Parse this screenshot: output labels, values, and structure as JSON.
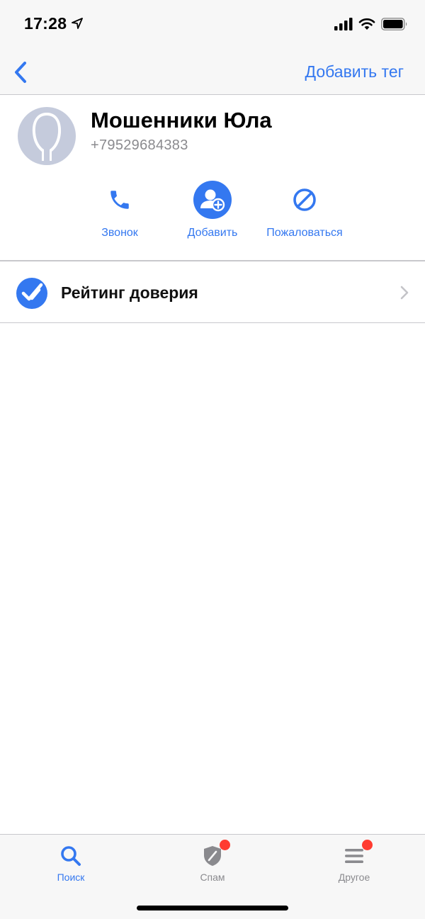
{
  "status_bar": {
    "time": "17:28"
  },
  "nav": {
    "action_label": "Добавить тег"
  },
  "contact": {
    "name": "Мошенники Юла",
    "phone": "+79529684383"
  },
  "actions": [
    {
      "label": "Звонок",
      "icon": "phone-icon"
    },
    {
      "label": "Добавить",
      "icon": "add-contact-icon"
    },
    {
      "label": "Пожаловаться",
      "icon": "block-icon"
    }
  ],
  "rating": {
    "label": "Рейтинг доверия",
    "icon": "double-check-icon"
  },
  "tabs": [
    {
      "label": "Поиск",
      "icon": "search-icon",
      "active": true
    },
    {
      "label": "Спам",
      "icon": "shield-icon",
      "active": false,
      "badge": true
    },
    {
      "label": "Другое",
      "icon": "menu-icon",
      "active": false,
      "badge": true
    }
  ],
  "colors": {
    "accent": "#3478f0",
    "badge": "#ff3b30",
    "avatar": "#c5cbdc"
  }
}
